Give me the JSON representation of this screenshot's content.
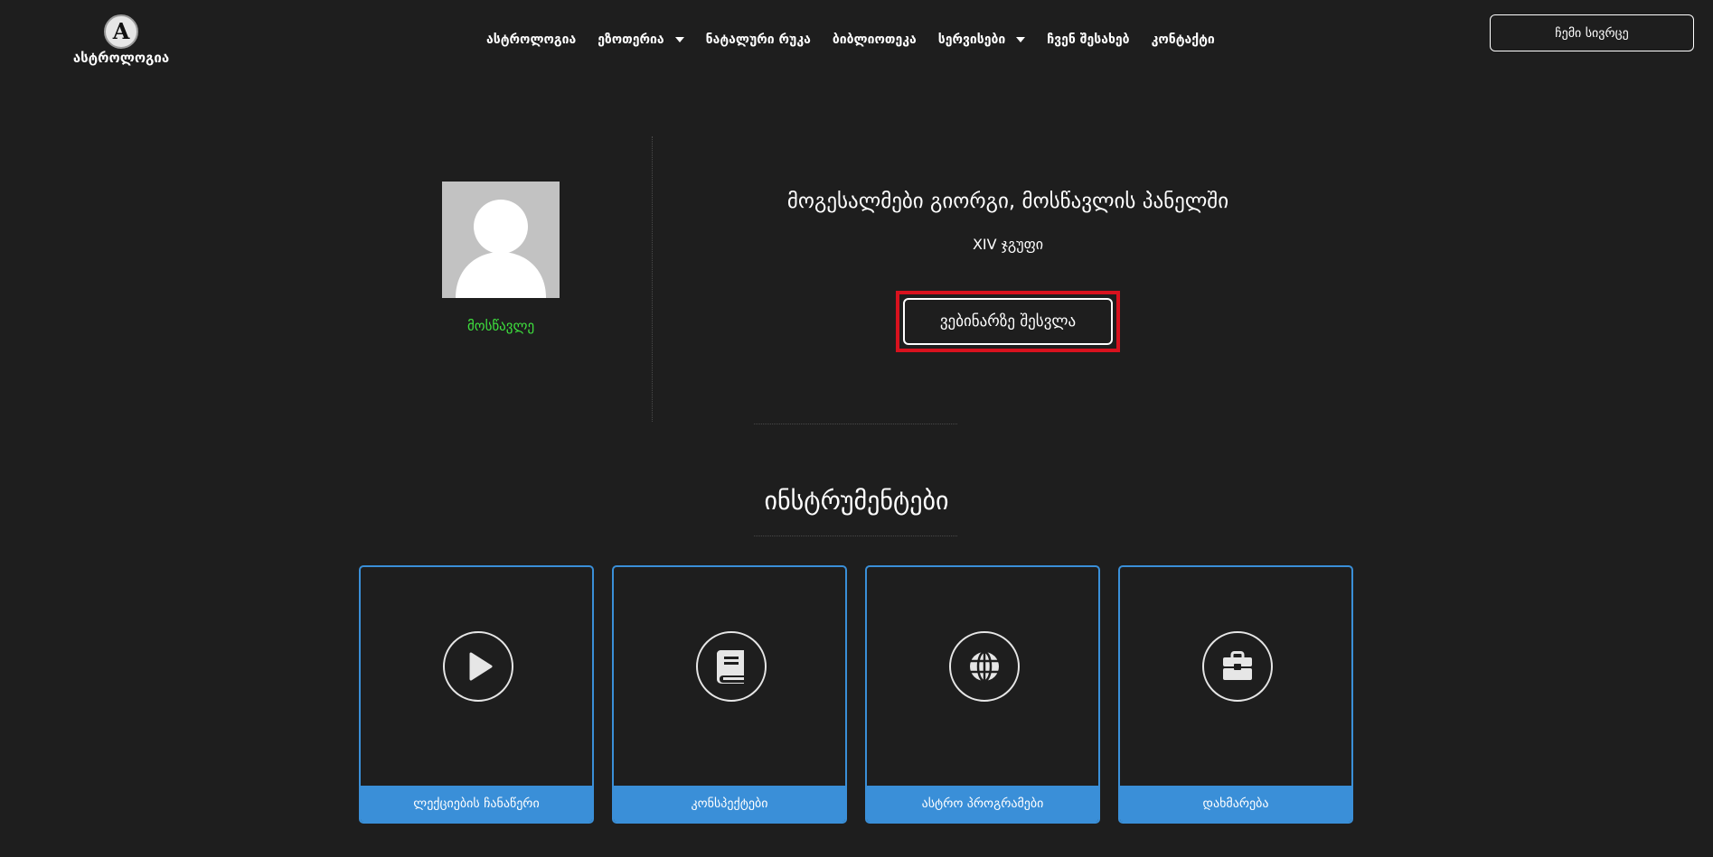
{
  "header": {
    "logo_letter": "A",
    "logo_text": "ასტროლოგია",
    "nav": [
      {
        "label": "ასტროლოგია",
        "dropdown": false
      },
      {
        "label": "ეზოთერია",
        "dropdown": true
      },
      {
        "label": "ნატალური რუკა",
        "dropdown": false
      },
      {
        "label": "ბიბლიოთეკა",
        "dropdown": false
      },
      {
        "label": "სერვისები",
        "dropdown": true
      },
      {
        "label": "ჩვენ შესახებ",
        "dropdown": false
      },
      {
        "label": "კონტაქტი",
        "dropdown": false
      }
    ],
    "room_button": "ჩემი სივრცე"
  },
  "profile": {
    "role": "მოსწავლე",
    "role_color": "#3ee03e"
  },
  "main": {
    "welcome": "მოგესალმები გიორგი, მოსწავლის პანელში",
    "group": "XIV ჯგუფი",
    "webinar_button": "ვებინარზე შესვლა",
    "highlight_color": "#d8121e"
  },
  "tools": {
    "title": "ინსტრუმენტები",
    "accent_color": "#3a8fd8",
    "cards": [
      {
        "label": "ლექციების ჩანაწერი",
        "icon": "play-icon"
      },
      {
        "label": "კონსპექტები",
        "icon": "book-icon"
      },
      {
        "label": "ასტრო პროგრამები",
        "icon": "globe-icon"
      },
      {
        "label": "დახმარება",
        "icon": "toolbox-icon"
      }
    ]
  }
}
